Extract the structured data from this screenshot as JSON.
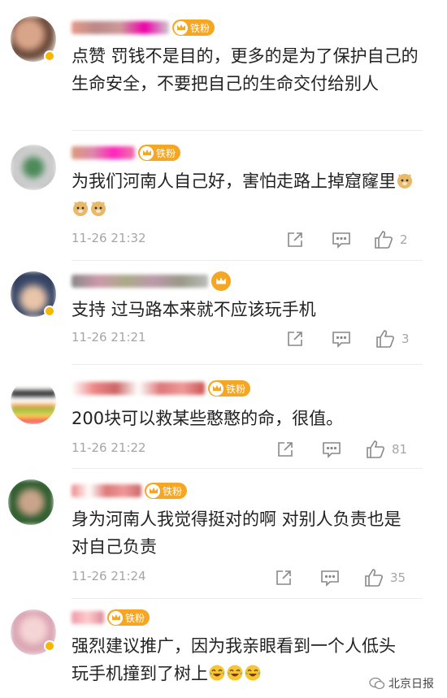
{
  "comments": [
    {
      "text": "点赞 罚钱不是目的，更多的是为了保护自己的生命安全，不要把自己的生命交付给别人",
      "badge": "铁粉"
    },
    {
      "text": "为我们河南人自己好，害怕走路上掉窟窿里",
      "badge": "铁粉",
      "emoji": [
        "doge-emoji",
        "doge-emoji",
        "doge-emoji"
      ],
      "time": "11-26 21:32",
      "likes": "2"
    },
    {
      "text": "支持 过马路本来就不应该玩手机",
      "time": "11-26 21:21",
      "likes": "3"
    },
    {
      "text": "200块可以救某些憨憨的命，很值。",
      "badge": "铁粉",
      "time": "11-26 21:22",
      "likes": "81"
    },
    {
      "text": "身为河南人我觉得挺对的啊  对别人负责也是对自己负责",
      "badge": "铁粉",
      "time": "11-26 21:24",
      "likes": "35"
    },
    {
      "text": "强烈建议推广，因为我亲眼看到一个人低头玩手机撞到了树上",
      "badge": "铁粉",
      "emoji": [
        "laugh-cry-emoji",
        "laugh-cry-emoji",
        "laugh-cry-emoji"
      ]
    }
  ],
  "watermark": "北京日报",
  "colors": {
    "badge": "#f5a623",
    "meta_gray": "#a6a6a6",
    "text": "#222222"
  }
}
